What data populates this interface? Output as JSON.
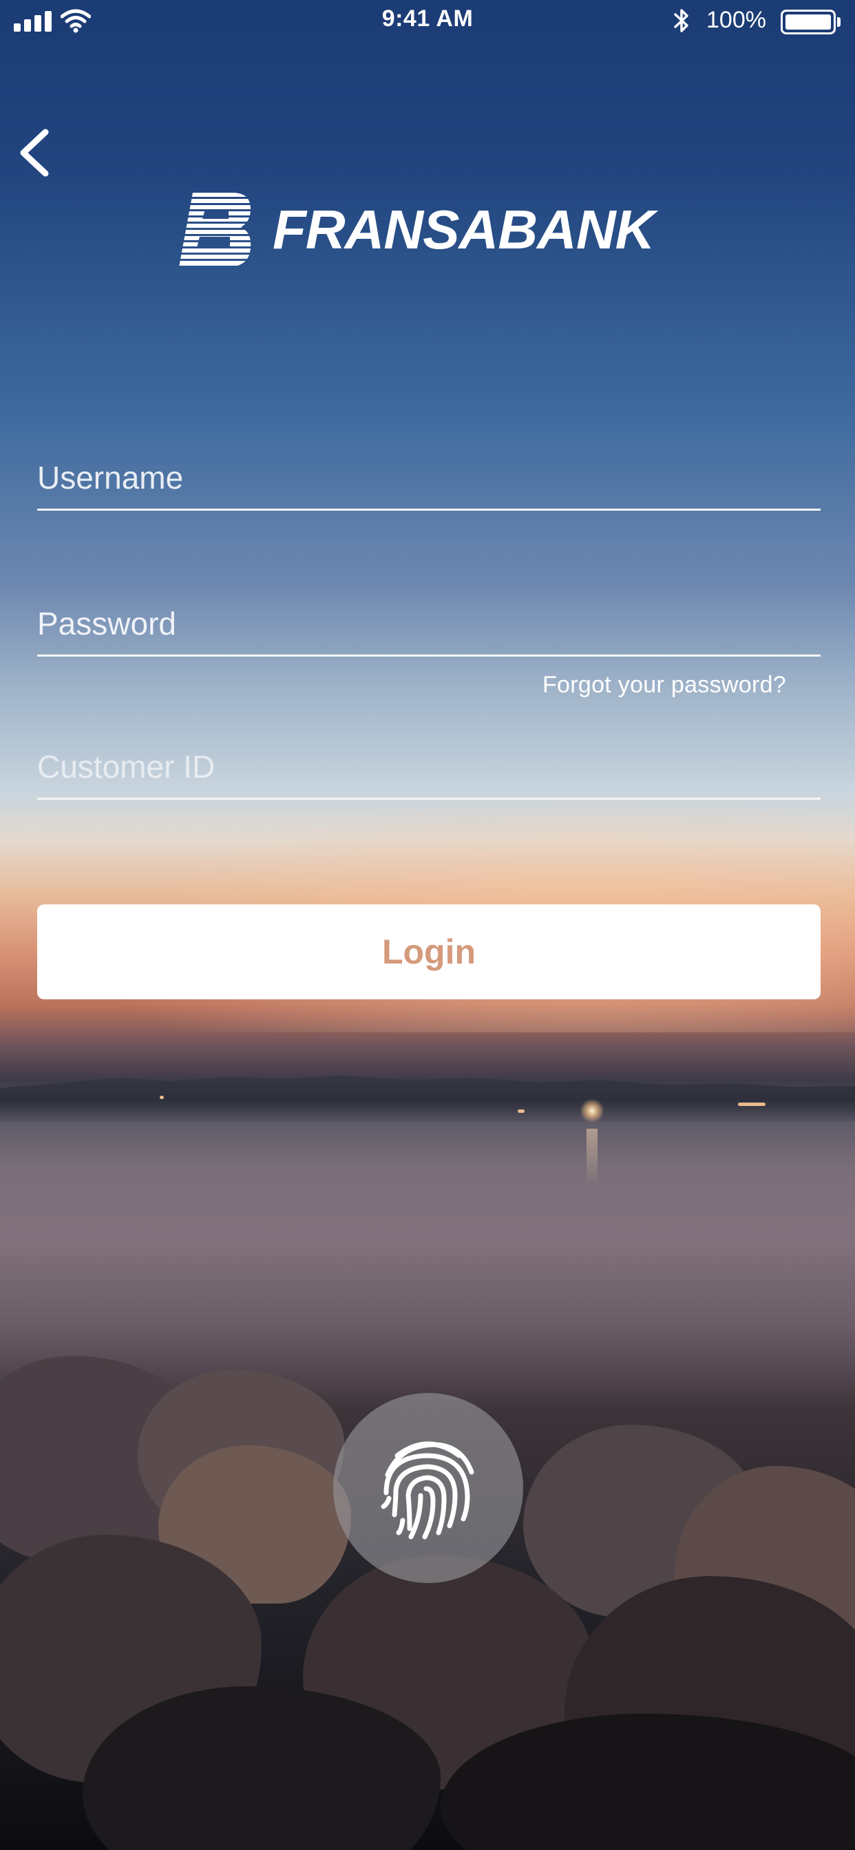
{
  "status_bar": {
    "time": "9:41 AM",
    "battery_percent": "100%",
    "signal_bars": 4,
    "icons": [
      "cellular-signal-icon",
      "wifi-icon",
      "bluetooth-icon",
      "battery-icon"
    ]
  },
  "nav": {
    "back_icon": "chevron-left-icon"
  },
  "brand": {
    "name": "FRANSABANK",
    "logo_icon": "fransabank-b-logo-icon"
  },
  "form": {
    "username_placeholder": "Username",
    "username_value": "",
    "password_placeholder": "Password",
    "password_value": "",
    "forgot_password_label": "Forgot your password?",
    "customer_id_placeholder": "Customer ID",
    "customer_id_value": "",
    "login_label": "Login",
    "fingerprint_icon": "fingerprint-icon"
  },
  "colors": {
    "login_text": "#d59a7c",
    "field_line": "#ffffff",
    "text": "#ffffff"
  }
}
